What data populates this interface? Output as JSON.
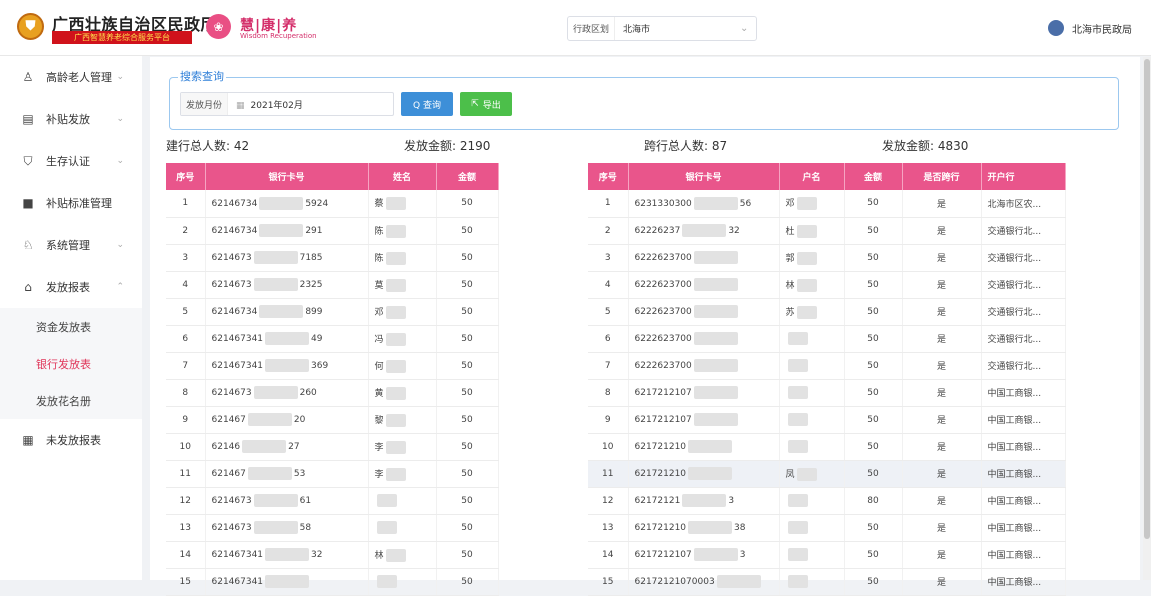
{
  "header": {
    "title": "广西壮族自治区民政厅",
    "subtitle": "广西智慧养老综合服务平台",
    "product_title": "慧|康|养",
    "product_sub": "Wisdom Recuperation",
    "region_label": "行政区划",
    "region_value": "北海市",
    "user_name": "北海市民政局"
  },
  "sidebar": {
    "items": [
      {
        "label": "高龄老人管理",
        "icon": "people-icon"
      },
      {
        "label": "补贴发放",
        "icon": "document-icon"
      },
      {
        "label": "生存认证",
        "icon": "shield-icon"
      },
      {
        "label": "补贴标准管理",
        "icon": "book-icon"
      },
      {
        "label": "系统管理",
        "icon": "user-settings-icon"
      },
      {
        "label": "发放报表",
        "icon": "report-icon"
      }
    ],
    "sub_items": [
      {
        "label": "资金发放表"
      },
      {
        "label": "银行发放表"
      },
      {
        "label": "发放花名册"
      }
    ],
    "last_item": {
      "label": "未发放报表",
      "icon": "table-icon"
    }
  },
  "search": {
    "legend": "搜索查询",
    "month_label": "发放月份",
    "month_value": "2021年02月",
    "query_label": "Q 查询",
    "export_label": "导出"
  },
  "stats": {
    "ccb_count_label": "建行总人数:",
    "ccb_count": "42",
    "ccb_amount_label": "发放金额:",
    "ccb_amount": "2190",
    "cross_count_label": "跨行总人数:",
    "cross_count": "87",
    "cross_amount_label": "发放金额:",
    "cross_amount": "4830"
  },
  "left_table": {
    "headers": [
      "序号",
      "银行卡号",
      "姓名",
      "金额"
    ],
    "rows": [
      {
        "no": "1",
        "card_a": "62146734",
        "card_b": "5924",
        "name": "蔡",
        "amount": "50"
      },
      {
        "no": "2",
        "card_a": "62146734",
        "card_b": "291",
        "name": "陈",
        "amount": "50"
      },
      {
        "no": "3",
        "card_a": "6214673",
        "card_b": "7185",
        "name": "陈",
        "amount": "50"
      },
      {
        "no": "4",
        "card_a": "6214673",
        "card_b": "2325",
        "name": "莫",
        "amount": "50"
      },
      {
        "no": "5",
        "card_a": "62146734",
        "card_b": "899",
        "name": "邓",
        "amount": "50"
      },
      {
        "no": "6",
        "card_a": "621467341",
        "card_b": "49",
        "name": "冯",
        "amount": "50"
      },
      {
        "no": "7",
        "card_a": "621467341",
        "card_b": "369",
        "name": "何",
        "amount": "50"
      },
      {
        "no": "8",
        "card_a": "6214673",
        "card_b": "260",
        "name": "黄",
        "amount": "50"
      },
      {
        "no": "9",
        "card_a": "621467",
        "card_b": "20",
        "name": "黎",
        "amount": "50"
      },
      {
        "no": "10",
        "card_a": "62146",
        "card_b": "27",
        "name": "李",
        "amount": "50"
      },
      {
        "no": "11",
        "card_a": "621467",
        "card_b": "53",
        "name": "李",
        "amount": "50"
      },
      {
        "no": "12",
        "card_a": "6214673",
        "card_b": "61",
        "name": "",
        "amount": "50"
      },
      {
        "no": "13",
        "card_a": "6214673",
        "card_b": "58",
        "name": "",
        "amount": "50"
      },
      {
        "no": "14",
        "card_a": "621467341",
        "card_b": "32",
        "name": "林",
        "amount": "50"
      },
      {
        "no": "15",
        "card_a": "621467341",
        "card_b": "",
        "name": "",
        "amount": "50"
      }
    ]
  },
  "right_table": {
    "headers": [
      "序号",
      "银行卡号",
      "户名",
      "金额",
      "是否跨行",
      "开户行"
    ],
    "rows": [
      {
        "no": "1",
        "card_a": "6231330300",
        "card_b": "56",
        "name": "邓",
        "amount": "50",
        "cross": "是",
        "bank": "北海市区农..."
      },
      {
        "no": "2",
        "card_a": "62226237",
        "card_b": "32",
        "name": "杜",
        "amount": "50",
        "cross": "是",
        "bank": "交通银行北..."
      },
      {
        "no": "3",
        "card_a": "6222623700",
        "card_b": "",
        "name": "郭",
        "amount": "50",
        "cross": "是",
        "bank": "交通银行北..."
      },
      {
        "no": "4",
        "card_a": "6222623700",
        "card_b": "",
        "name": "林",
        "amount": "50",
        "cross": "是",
        "bank": "交通银行北..."
      },
      {
        "no": "5",
        "card_a": "6222623700",
        "card_b": "",
        "name": "苏",
        "amount": "50",
        "cross": "是",
        "bank": "交通银行北..."
      },
      {
        "no": "6",
        "card_a": "6222623700",
        "card_b": "",
        "name": "",
        "amount": "50",
        "cross": "是",
        "bank": "交通银行北..."
      },
      {
        "no": "7",
        "card_a": "6222623700",
        "card_b": "",
        "name": "",
        "amount": "50",
        "cross": "是",
        "bank": "交通银行北..."
      },
      {
        "no": "8",
        "card_a": "6217212107",
        "card_b": "",
        "name": "",
        "amount": "50",
        "cross": "是",
        "bank": "中国工商银..."
      },
      {
        "no": "9",
        "card_a": "6217212107",
        "card_b": "",
        "name": "",
        "amount": "50",
        "cross": "是",
        "bank": "中国工商银..."
      },
      {
        "no": "10",
        "card_a": "621721210",
        "card_b": "",
        "name": "",
        "amount": "50",
        "cross": "是",
        "bank": "中国工商银..."
      },
      {
        "no": "11",
        "card_a": "621721210",
        "card_b": "",
        "name": "凤",
        "amount": "50",
        "cross": "是",
        "bank": "中国工商银..."
      },
      {
        "no": "12",
        "card_a": "62172121",
        "card_b": "3",
        "name": "",
        "amount": "80",
        "cross": "是",
        "bank": "中国工商银..."
      },
      {
        "no": "13",
        "card_a": "621721210",
        "card_b": "38",
        "name": "",
        "amount": "50",
        "cross": "是",
        "bank": "中国工商银..."
      },
      {
        "no": "14",
        "card_a": "6217212107",
        "card_b": "3",
        "name": "",
        "amount": "50",
        "cross": "是",
        "bank": "中国工商银..."
      },
      {
        "no": "15",
        "card_a": "62172121070003",
        "card_b": "",
        "name": "",
        "amount": "50",
        "cross": "是",
        "bank": "中国工商银..."
      }
    ],
    "highlight_row": "11"
  }
}
